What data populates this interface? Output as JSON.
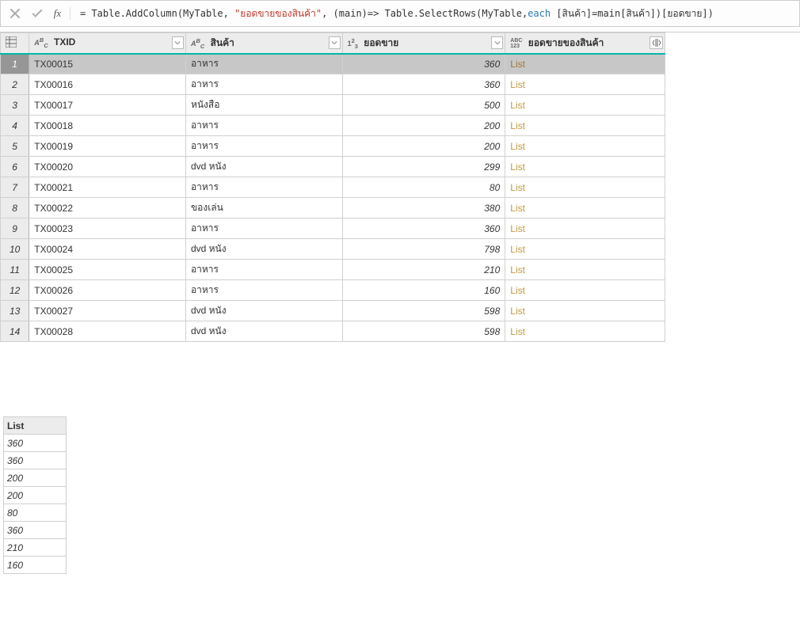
{
  "formula": {
    "prefix_eq": "= ",
    "fn1": "Table.AddColumn",
    "open1": "(MyTable, ",
    "str": "\"ยอดขายของสินค้า\"",
    "mid": ", (main)=> ",
    "fn2": "Table.SelectRows",
    "open2": "(MyTable,",
    "each_kw": "each ",
    "tail": "[สินค้า]=main[สินค้า])[ยอดขาย])"
  },
  "columns": {
    "txid": "TXID",
    "product": "สินค้า",
    "sales": "ยอดขาย",
    "list": "ยอดขายของสินค้า"
  },
  "link_label": "List",
  "rows": [
    {
      "n": "1",
      "txid": "TX00015",
      "product": "อาหาร",
      "sales": "360"
    },
    {
      "n": "2",
      "txid": "TX00016",
      "product": "อาหาร",
      "sales": "360"
    },
    {
      "n": "3",
      "txid": "TX00017",
      "product": "หนังสือ",
      "sales": "500"
    },
    {
      "n": "4",
      "txid": "TX00018",
      "product": "อาหาร",
      "sales": "200"
    },
    {
      "n": "5",
      "txid": "TX00019",
      "product": "อาหาร",
      "sales": "200"
    },
    {
      "n": "6",
      "txid": "TX00020",
      "product": "dvd หนัง",
      "sales": "299"
    },
    {
      "n": "7",
      "txid": "TX00021",
      "product": "อาหาร",
      "sales": "80"
    },
    {
      "n": "8",
      "txid": "TX00022",
      "product": "ของเล่น",
      "sales": "380"
    },
    {
      "n": "9",
      "txid": "TX00023",
      "product": "อาหาร",
      "sales": "360"
    },
    {
      "n": "10",
      "txid": "TX00024",
      "product": "dvd หนัง",
      "sales": "798"
    },
    {
      "n": "11",
      "txid": "TX00025",
      "product": "อาหาร",
      "sales": "210"
    },
    {
      "n": "12",
      "txid": "TX00026",
      "product": "อาหาร",
      "sales": "160"
    },
    {
      "n": "13",
      "txid": "TX00027",
      "product": "dvd หนัง",
      "sales": "598"
    },
    {
      "n": "14",
      "txid": "TX00028",
      "product": "dvd หนัง",
      "sales": "598"
    }
  ],
  "preview": {
    "header": "List",
    "values": [
      "360",
      "360",
      "200",
      "200",
      "80",
      "360",
      "210",
      "160"
    ]
  },
  "type_icons": {
    "text": "Aᴮc",
    "number": "1²₃",
    "any": "ABC\n123"
  }
}
